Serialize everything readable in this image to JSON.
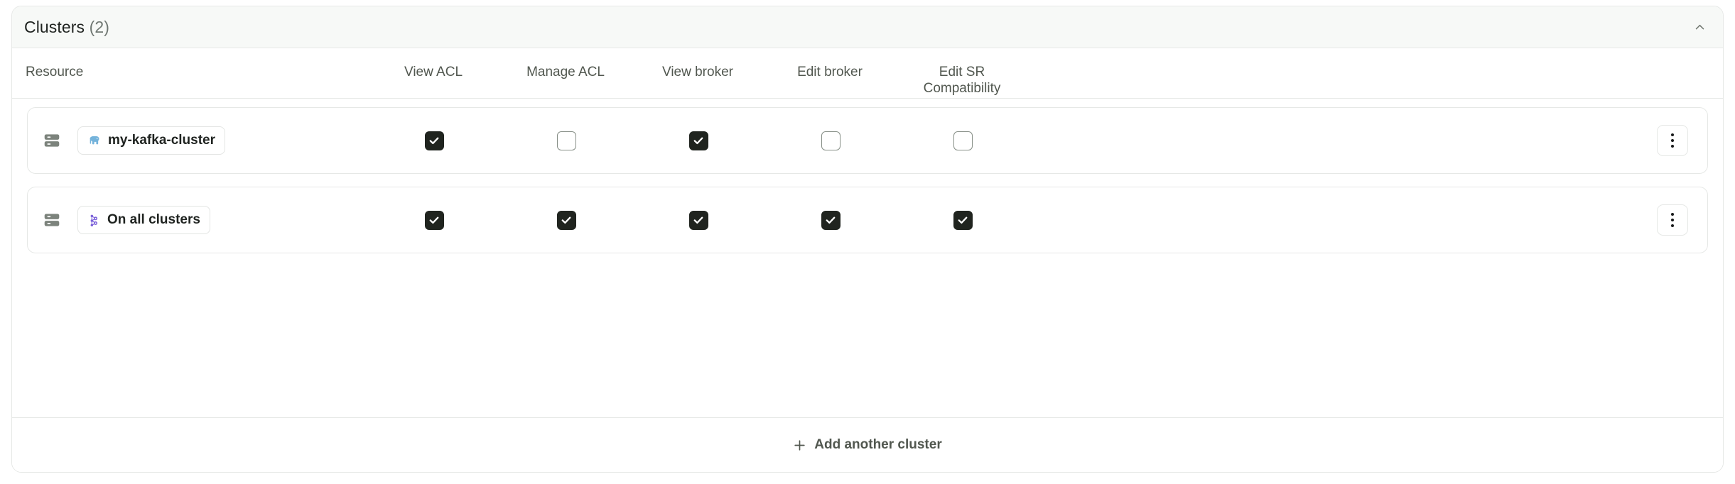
{
  "panel": {
    "title": "Clusters",
    "count": "(2)",
    "collapse_icon": "chevron-up-icon",
    "accent_dark": "#20241f",
    "header_bg": "#f7f9f7",
    "border_color": "#e6e8e6"
  },
  "columns": [
    {
      "key": "resource",
      "label": "Resource"
    },
    {
      "key": "view_acl",
      "label": "View ACL"
    },
    {
      "key": "manage_acl",
      "label": "Manage ACL"
    },
    {
      "key": "view_broker",
      "label": "View broker"
    },
    {
      "key": "edit_broker",
      "label": "Edit broker"
    },
    {
      "key": "edit_sr_compat",
      "label": "Edit SR\nCompatibility"
    }
  ],
  "rows": [
    {
      "resource_icon": "server-icon",
      "chip_icon": "elephant-icon",
      "chip_icon_color": "#74b3db",
      "label": "my-kafka-cluster",
      "view_acl": true,
      "manage_acl": false,
      "view_broker": true,
      "edit_broker": false,
      "edit_sr_compat": false,
      "menu_icon": "kebab-menu-icon"
    },
    {
      "resource_icon": "server-icon",
      "chip_icon": "cluster-graph-icon",
      "chip_icon_color": "#7b61d9",
      "label": "On all clusters",
      "view_acl": true,
      "manage_acl": true,
      "view_broker": true,
      "edit_broker": true,
      "edit_sr_compat": true,
      "menu_icon": "kebab-menu-icon"
    }
  ],
  "footer": {
    "add_icon": "plus-icon",
    "add_label": "Add another cluster"
  }
}
